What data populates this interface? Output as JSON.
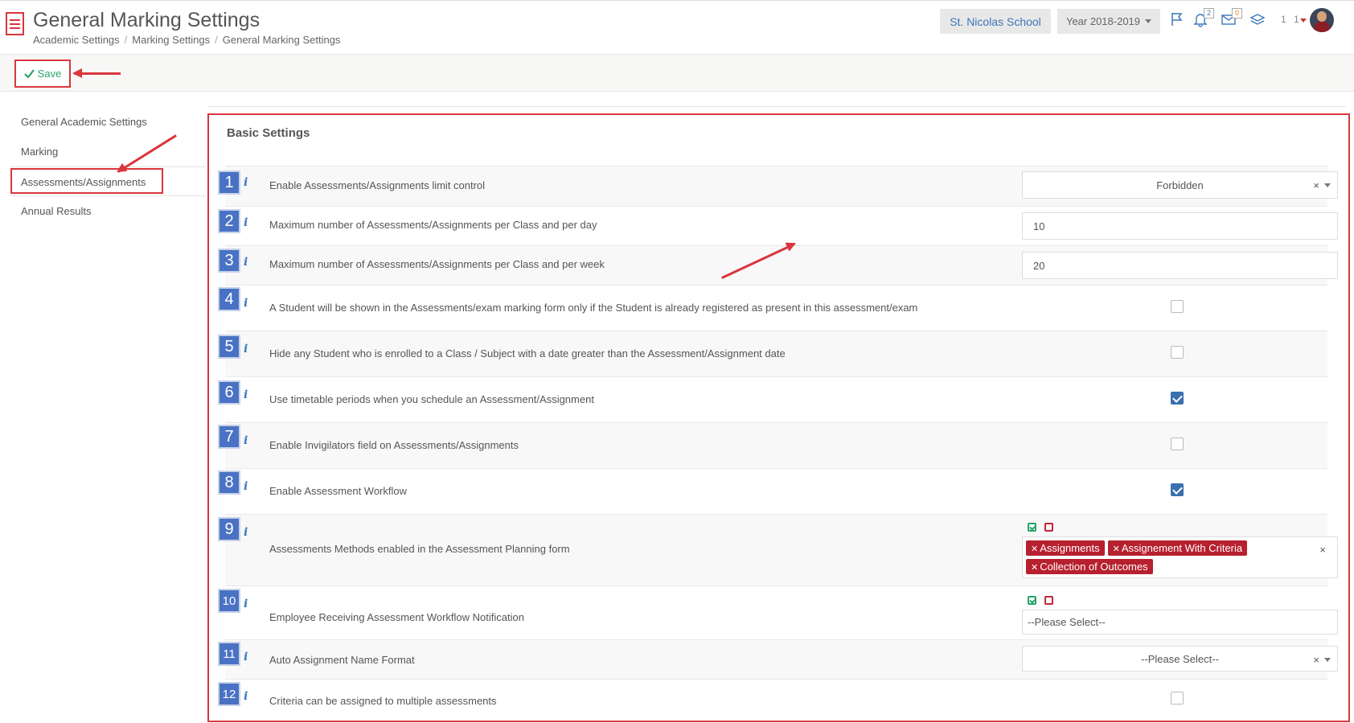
{
  "header": {
    "title": "General Marking Settings",
    "breadcrumb": [
      "Academic Settings",
      "Marking Settings",
      "General Marking Settings"
    ],
    "breadcrumb_sep": "/",
    "school": "St. Nicolas School",
    "year": "Year 2018-2019",
    "notifications_count": "2",
    "messages_count": "0",
    "user_label": "1 1"
  },
  "toolbar": {
    "save_label": "Save"
  },
  "sidebar": {
    "items": [
      {
        "label": "General Academic Settings"
      },
      {
        "label": "Marking"
      },
      {
        "label": "Assessments/Assignments"
      },
      {
        "label": "Annual Results"
      }
    ]
  },
  "main": {
    "section_title": "Basic Settings",
    "rows": [
      {
        "num": "1",
        "label": "Enable Assessments/Assignments limit control",
        "type": "select",
        "value": "Forbidden"
      },
      {
        "num": "2",
        "label": "Maximum number of Assessments/Assignments per Class and per day",
        "type": "input",
        "value": "10"
      },
      {
        "num": "3",
        "label": "Maximum number of Assessments/Assignments per Class and per week",
        "type": "input",
        "value": "20"
      },
      {
        "num": "4",
        "label": "A Student will be shown in the Assessments/exam marking form only if the Student is already registered as present in this assessment/exam",
        "type": "checkbox",
        "checked": false
      },
      {
        "num": "5",
        "label": "Hide any Student who is enrolled to a Class / Subject with a date greater than the Assessment/Assignment date",
        "type": "checkbox",
        "checked": false
      },
      {
        "num": "6",
        "label": "Use timetable periods when you schedule an Assessment/Assignment",
        "type": "checkbox",
        "checked": true
      },
      {
        "num": "7",
        "label": "Enable Invigilators field on Assessments/Assignments",
        "type": "checkbox",
        "checked": false
      },
      {
        "num": "8",
        "label": "Enable Assessment Workflow",
        "type": "checkbox",
        "checked": true
      },
      {
        "num": "9",
        "label": "Assessments Methods enabled in the Assessment Planning form",
        "type": "multiselect",
        "tags": [
          "Assignments",
          "Assignement With Criteria",
          "Collection of Outcomes"
        ]
      },
      {
        "num": "10",
        "label": "Employee Receiving Assessment Workflow Notification",
        "type": "multiselect-empty",
        "placeholder": "--Please Select--"
      },
      {
        "num": "11",
        "label": "Auto Assignment Name Format",
        "type": "select",
        "value": "--Please Select--"
      },
      {
        "num": "12",
        "label": "Criteria can be assigned to multiple assessments",
        "type": "checkbox",
        "checked": false
      }
    ]
  },
  "icons": {
    "menu": "hamburger-menu-icon",
    "flag": "flag-icon",
    "bell": "bell-icon",
    "envelope": "envelope-icon",
    "layers": "layers-icon",
    "info": "info-icon",
    "check": "check-icon"
  },
  "colors": {
    "accent_red": "#d9363e",
    "save_green": "#2aa36b",
    "link_blue": "#3b78b5",
    "tag_red": "#b7202e",
    "number_badge": "#4a72c4",
    "checkbox_on": "#3a6fb0"
  }
}
